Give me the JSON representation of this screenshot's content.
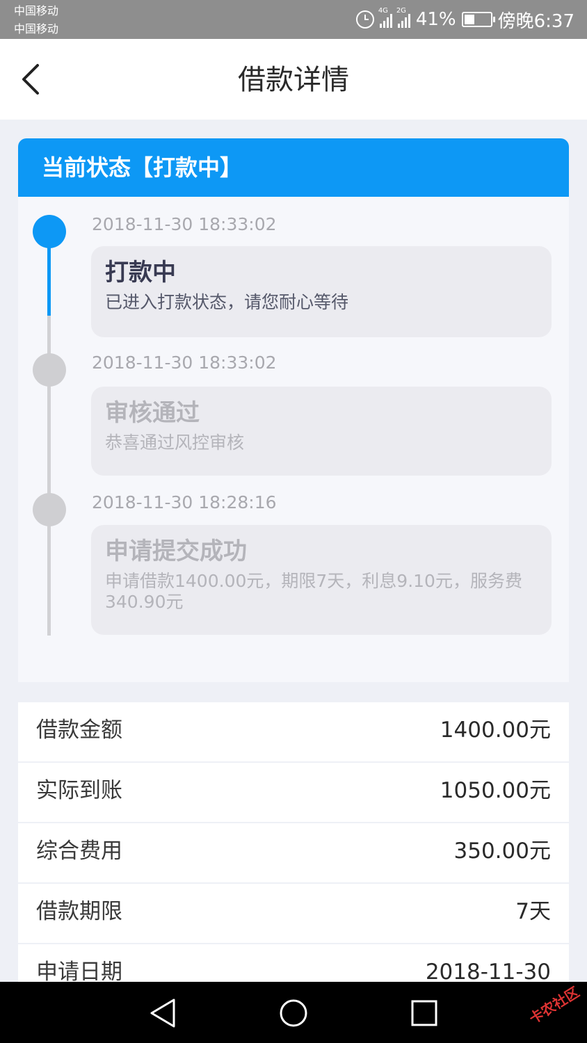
{
  "status_bar": {
    "carrier1": "中国移动",
    "carrier2": "中国移动",
    "net1": "4G",
    "net2": "2G",
    "battery": "41%",
    "battery_level": 0.41,
    "time": "傍晚6:37"
  },
  "nav": {
    "title": "借款详情",
    "back_icon": "chevron-left-icon"
  },
  "status": {
    "header": "当前状态【打款中】",
    "timeline": [
      {
        "time": "2018-11-30 18:33:02",
        "title": "打款中",
        "desc": "已进入打款状态，请您耐心等待"
      },
      {
        "time": "2018-11-30 18:33:02",
        "title": "审核通过",
        "desc": "恭喜通过风控审核"
      },
      {
        "time": "2018-11-30 18:28:16",
        "title": "申请提交成功",
        "desc": "申请借款1400.00元，期限7天，利息9.10元，服务费340.90元"
      }
    ]
  },
  "details": [
    {
      "label": "借款金额",
      "value": "1400.00元"
    },
    {
      "label": "实际到账",
      "value": "1050.00元"
    },
    {
      "label": "综合费用",
      "value": "350.00元"
    },
    {
      "label": "借款期限",
      "value": "7天"
    },
    {
      "label": "申请日期",
      "value": "2018-11-30"
    }
  ],
  "watermark": "卡农社区",
  "colors": {
    "accent": "#0d98f5",
    "status_bar": "#8e8e8e"
  }
}
